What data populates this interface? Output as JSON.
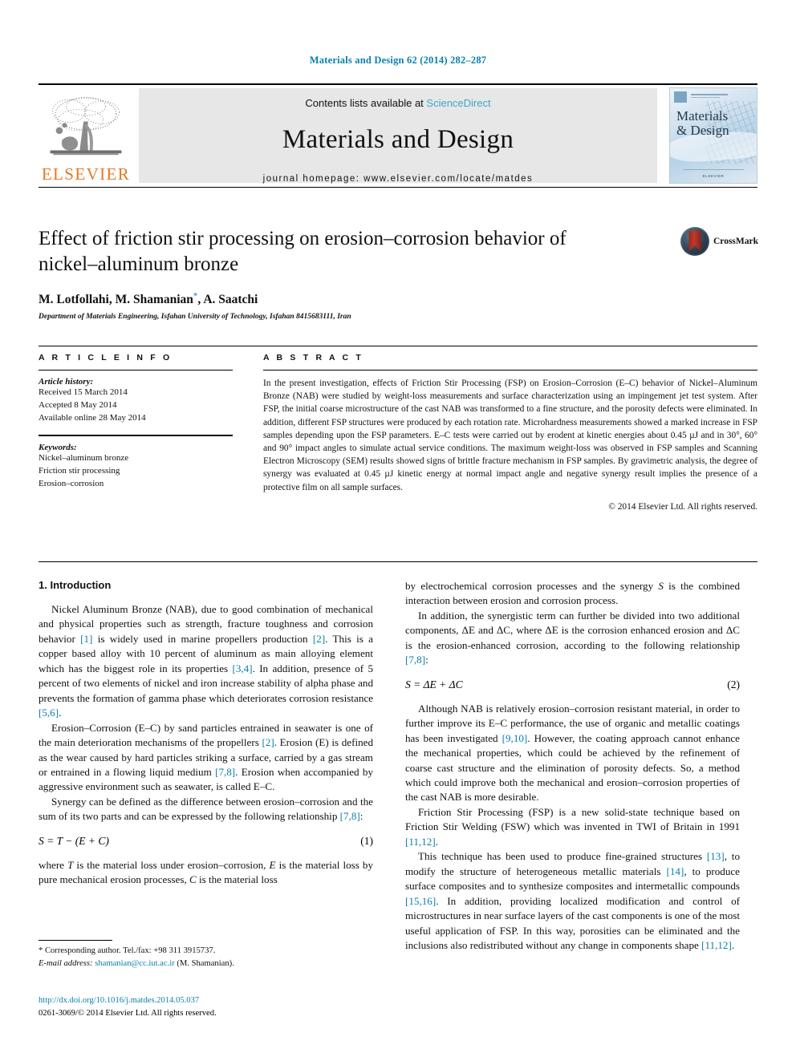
{
  "running_head": "Materials and Design 62 (2014) 282–287",
  "header": {
    "contents_prefix": "Contents lists available at ",
    "sciencedirect": "ScienceDirect",
    "journal_title": "Materials and Design",
    "homepage": "journal homepage: www.elsevier.com/locate/matdes",
    "publisher_wordmark": "ELSEVIER",
    "cover": {
      "line1": "Materials",
      "line2": "& Design",
      "footer": "ELSEVIER"
    }
  },
  "article": {
    "title": "Effect of friction stir processing on erosion–corrosion behavior of nickel–aluminum bronze",
    "authors_pre": "M. Lotfollahi, M. Shamanian",
    "corresponding_mark": "*",
    "authors_post": ", A. Saatchi",
    "affiliation": "Department of Materials Engineering, Isfahan University of Technology, Isfahan 8415683111, Iran",
    "crossmark_label": "CrossMark"
  },
  "article_info": {
    "heading": "A R T I C L E   I N F O",
    "history_label": "Article history:",
    "history": [
      "Received 15 March 2014",
      "Accepted 8 May 2014",
      "Available online 28 May 2014"
    ],
    "keywords_label": "Keywords:",
    "keywords": [
      "Nickel–aluminum bronze",
      "Friction stir processing",
      "Erosion–corrosion"
    ]
  },
  "abstract": {
    "heading": "A B S T R A C T",
    "text": "In the present investigation, effects of Friction Stir Processing (FSP) on Erosion–Corrosion (E–C) behavior of Nickel–Aluminum Bronze (NAB) were studied by weight-loss measurements and surface characterization using an impingement jet test system. After FSP, the initial coarse microstructure of the cast NAB was transformed to a fine structure, and the porosity defects were eliminated. In addition, different FSP structures were produced by each rotation rate. Microhardness measurements showed a marked increase in FSP samples depending upon the FSP parameters. E–C tests were carried out by erodent at kinetic energies about 0.45 µJ and in 30°, 60° and 90° impact angles to simulate actual service conditions. The maximum weight-loss was observed in FSP samples and Scanning Electron Microscopy (SEM) results showed signs of brittle fracture mechanism in FSP samples. By gravimetric analysis, the degree of synergy was evaluated at 0.45 µJ kinetic energy at normal impact angle and negative synergy result implies the presence of a protective film on all sample surfaces.",
    "copyright": "© 2014 Elsevier Ltd. All rights reserved."
  },
  "introduction": {
    "heading": "1. Introduction",
    "left_paragraphs": [
      {
        "segments": [
          {
            "t": "Nickel Aluminum Bronze (NAB), due to good combination of mechanical and physical properties such as strength, fracture toughness and corrosion behavior "
          },
          {
            "t": "[1]",
            "ref": true
          },
          {
            "t": " is widely used in marine propellers production "
          },
          {
            "t": "[2]",
            "ref": true
          },
          {
            "t": ". This is a copper based alloy with 10 percent of aluminum as main alloying element which has the biggest role in its properties "
          },
          {
            "t": "[3,4]",
            "ref": true
          },
          {
            "t": ". In addition, presence of 5 percent of two elements of nickel and iron increase stability of alpha phase and prevents the formation of gamma phase which deteriorates corrosion resistance "
          },
          {
            "t": "[5,6]",
            "ref": true
          },
          {
            "t": "."
          }
        ]
      },
      {
        "segments": [
          {
            "t": "Erosion–Corrosion (E–C) by sand particles entrained in seawater is one of the main deterioration mechanisms of the propellers "
          },
          {
            "t": "[2]",
            "ref": true
          },
          {
            "t": ". Erosion (E) is defined as the wear caused by hard particles striking a surface, carried by a gas stream or entrained in a flowing liquid medium "
          },
          {
            "t": "[7,8]",
            "ref": true
          },
          {
            "t": ". Erosion when accompanied by aggressive environment such as seawater, is called E–C."
          }
        ]
      },
      {
        "segments": [
          {
            "t": "Synergy can be defined as the difference between erosion–corrosion and the sum of its two parts and can be expressed by the following relationship "
          },
          {
            "t": "[7,8]",
            "ref": true
          },
          {
            "t": ":"
          }
        ]
      }
    ],
    "equation1": {
      "body": "S = T − (E + C)",
      "number": "(1)"
    },
    "left_after_eq": {
      "segments": [
        {
          "t": "where "
        },
        {
          "t": "T",
          "it": true
        },
        {
          "t": " is the material loss under erosion–corrosion, "
        },
        {
          "t": "E",
          "it": true
        },
        {
          "t": " is the material loss by pure mechanical erosion processes, "
        },
        {
          "t": "C",
          "it": true
        },
        {
          "t": " is the material loss"
        }
      ]
    },
    "right_paragraphs_top": [
      {
        "segments": [
          {
            "t": "by electrochemical corrosion processes and the synergy "
          },
          {
            "t": "S",
            "it": true
          },
          {
            "t": " is the combined interaction between erosion and corrosion process."
          }
        ]
      },
      {
        "segments": [
          {
            "t": "In addition, the synergistic term can further be divided into two additional components, ΔE and ΔC, where ΔE is the corrosion enhanced erosion and ΔC is the erosion-enhanced corrosion, according to the following relationship "
          },
          {
            "t": "[7,8]",
            "ref": true
          },
          {
            "t": ":"
          }
        ]
      }
    ],
    "equation2": {
      "body": "S = ΔE + ΔC",
      "number": "(2)"
    },
    "right_paragraphs_bottom": [
      {
        "segments": [
          {
            "t": "Although NAB is relatively erosion–corrosion resistant material, in order to further improve its E–C performance, the use of organic and metallic coatings has been investigated "
          },
          {
            "t": "[9,10]",
            "ref": true
          },
          {
            "t": ". However, the coating approach cannot enhance the mechanical properties, which could be achieved by the refinement of coarse cast structure and the elimination of porosity defects. So, a method which could improve both the mechanical and erosion–corrosion properties of the cast NAB is more desirable."
          }
        ]
      },
      {
        "segments": [
          {
            "t": "Friction Stir Processing (FSP) is a new solid-state technique based on Friction Stir Welding (FSW) which was invented in TWI of Britain in 1991 "
          },
          {
            "t": "[11,12]",
            "ref": true
          },
          {
            "t": "."
          }
        ]
      },
      {
        "segments": [
          {
            "t": "This technique has been used to produce fine-grained structures "
          },
          {
            "t": "[13]",
            "ref": true
          },
          {
            "t": ", to modify the structure of heterogeneous metallic materials "
          },
          {
            "t": "[14]",
            "ref": true
          },
          {
            "t": ", to produce surface composites and to synthesize composites and intermetallic compounds "
          },
          {
            "t": "[15,16]",
            "ref": true
          },
          {
            "t": ". In addition, providing localized modification and control of microstructures in near surface layers of the cast components is one of the most useful application of FSP. In this way, porosities can be eliminated and the inclusions also redistributed without any change in components shape "
          },
          {
            "t": "[11,12]",
            "ref": true
          },
          {
            "t": "."
          }
        ]
      }
    ]
  },
  "footnote": {
    "corresponding": "* Corresponding author. Tel./fax: +98 311 3915737.",
    "email_label": "E-mail address:",
    "email": "shamanian@cc.iut.ac.ir",
    "email_suffix": "(M. Shamanian)."
  },
  "footer": {
    "doi": "http://dx.doi.org/10.1016/j.matdes.2014.05.037",
    "issn_line": "0261-3069/© 2014 Elsevier Ltd. All rights reserved."
  }
}
